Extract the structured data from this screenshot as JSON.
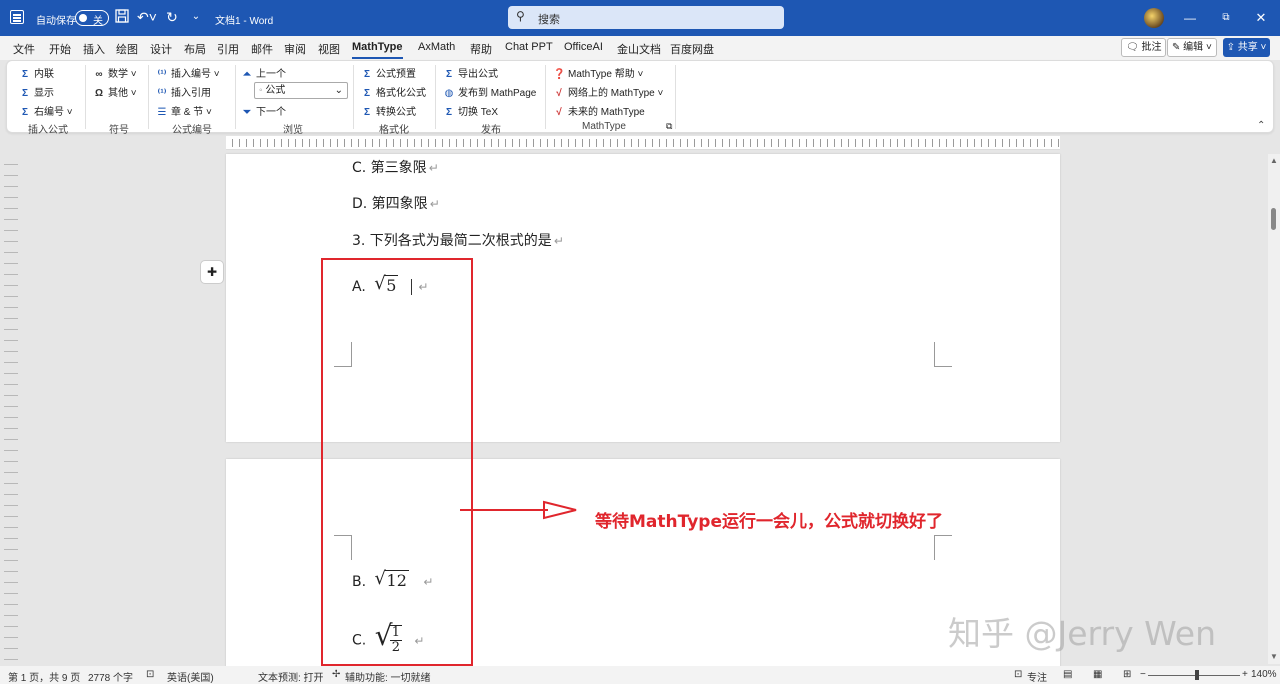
{
  "titlebar": {
    "autosave_label": "自动保存",
    "autosave_state": "关",
    "doc_title": "文档1  -  Word",
    "search_placeholder": "搜索",
    "accent": "#1e57b3"
  },
  "menu": {
    "tabs": [
      "文件",
      "开始",
      "插入",
      "绘图",
      "设计",
      "布局",
      "引用",
      "邮件",
      "审阅",
      "视图",
      "MathType",
      "AxMath",
      "帮助",
      "Chat PPT",
      "OfficeAI",
      "金山文档",
      "百度网盘"
    ],
    "active": "MathType",
    "comment": "批注",
    "edit": "编辑",
    "share": "共享"
  },
  "ribbon": {
    "insert_equation": {
      "inline": "内联",
      "display": "显示",
      "right_numbered": "右编号",
      "label": "插入公式"
    },
    "symbols": {
      "math": "数学",
      "other": "其他",
      "label": "符号"
    },
    "numbering": {
      "insert_number": "插入编号",
      "insert_ref": "插入引用",
      "chapter_section": "章 & 节",
      "label": "公式编号"
    },
    "browse": {
      "prev": "上一个",
      "select_value": "公式",
      "next": "下一个",
      "label": "浏览"
    },
    "format": {
      "preset": "公式预置",
      "format_eq": "格式化公式",
      "convert": "转换公式",
      "label": "格式化"
    },
    "publish": {
      "export": "导出公式",
      "to_mathpage": "发布到 MathPage",
      "toggle_tex": "切换 TeX",
      "label": "发布"
    },
    "mathtype": {
      "help": "MathType 帮助",
      "online": "网络上的 MathType",
      "future": "未来的 MathType",
      "label": "MathType"
    }
  },
  "document": {
    "page1_lines": [
      "C.  第三象限",
      "D.  第四象限",
      "3.  下列各式为最简二次根式的是"
    ],
    "option_a_label": "A.",
    "option_a_radicand": "5",
    "option_b_label": "B.",
    "option_b_radicand": "12",
    "option_c_label": "C.",
    "option_c_num": "1",
    "option_c_den": "2",
    "para_mark": "↵"
  },
  "annotation": {
    "text": "等待MathType运行一会儿，公式就切换好了",
    "color": "#e0262d"
  },
  "watermark": "知乎 @Jerry Wen",
  "status": {
    "page": "第 1 页，共 9 页",
    "words": "2778 个字",
    "lang": "英语(美国)",
    "prediction": "文本预测: 打开",
    "accessibility": "辅助功能: 一切就绪",
    "focus": "专注",
    "zoom": "140%"
  }
}
